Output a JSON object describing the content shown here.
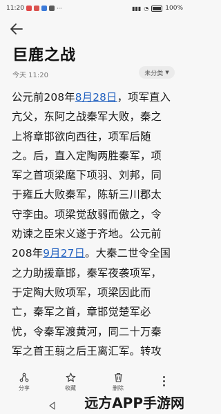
{
  "status": {
    "time": "11:20",
    "battery": "100%"
  },
  "note": {
    "title": "巨鹿之战",
    "timestamp": "今天 11:20",
    "category": "未分类"
  },
  "article": {
    "lines": [
      [
        "公元前208年",
        {
          "link": "8月28日"
        },
        "，项军直入"
      ],
      [
        "亢父，东阿之战秦军大败，秦之"
      ],
      [
        "上将章邯欲向西往，项军后随"
      ],
      [
        "之。后，直入定陶两胜秦军，项"
      ],
      [
        "军之首项梁麾下项羽、刘邦，同"
      ],
      [
        "于雍丘大败秦军，陈斩三川郡太"
      ],
      [
        "守李由。项梁觉敌弱而傲之，令"
      ],
      [
        "劝谏之臣宋义遂于齐地。公元前"
      ],
      [
        "208年",
        {
          "link": "9月27日"
        },
        "。大秦二世令全国"
      ],
      [
        "之力助援章邯，秦军夜袭项军，"
      ],
      [
        "于定陶大败项军，项梁因此而"
      ],
      [
        "亡，秦军之首，章邯觉楚军必"
      ],
      [
        "忧，令秦军渡黄河，同二十万秦"
      ],
      [
        "军之首王翦之后王离汇军。转攻"
      ]
    ]
  },
  "toolbar": {
    "share": "分享",
    "favorite": "收藏",
    "delete": "删除"
  },
  "watermark": "远方APP手游网",
  "colors": {
    "link": "#1f5fbf",
    "background": "#f7f7f7"
  }
}
